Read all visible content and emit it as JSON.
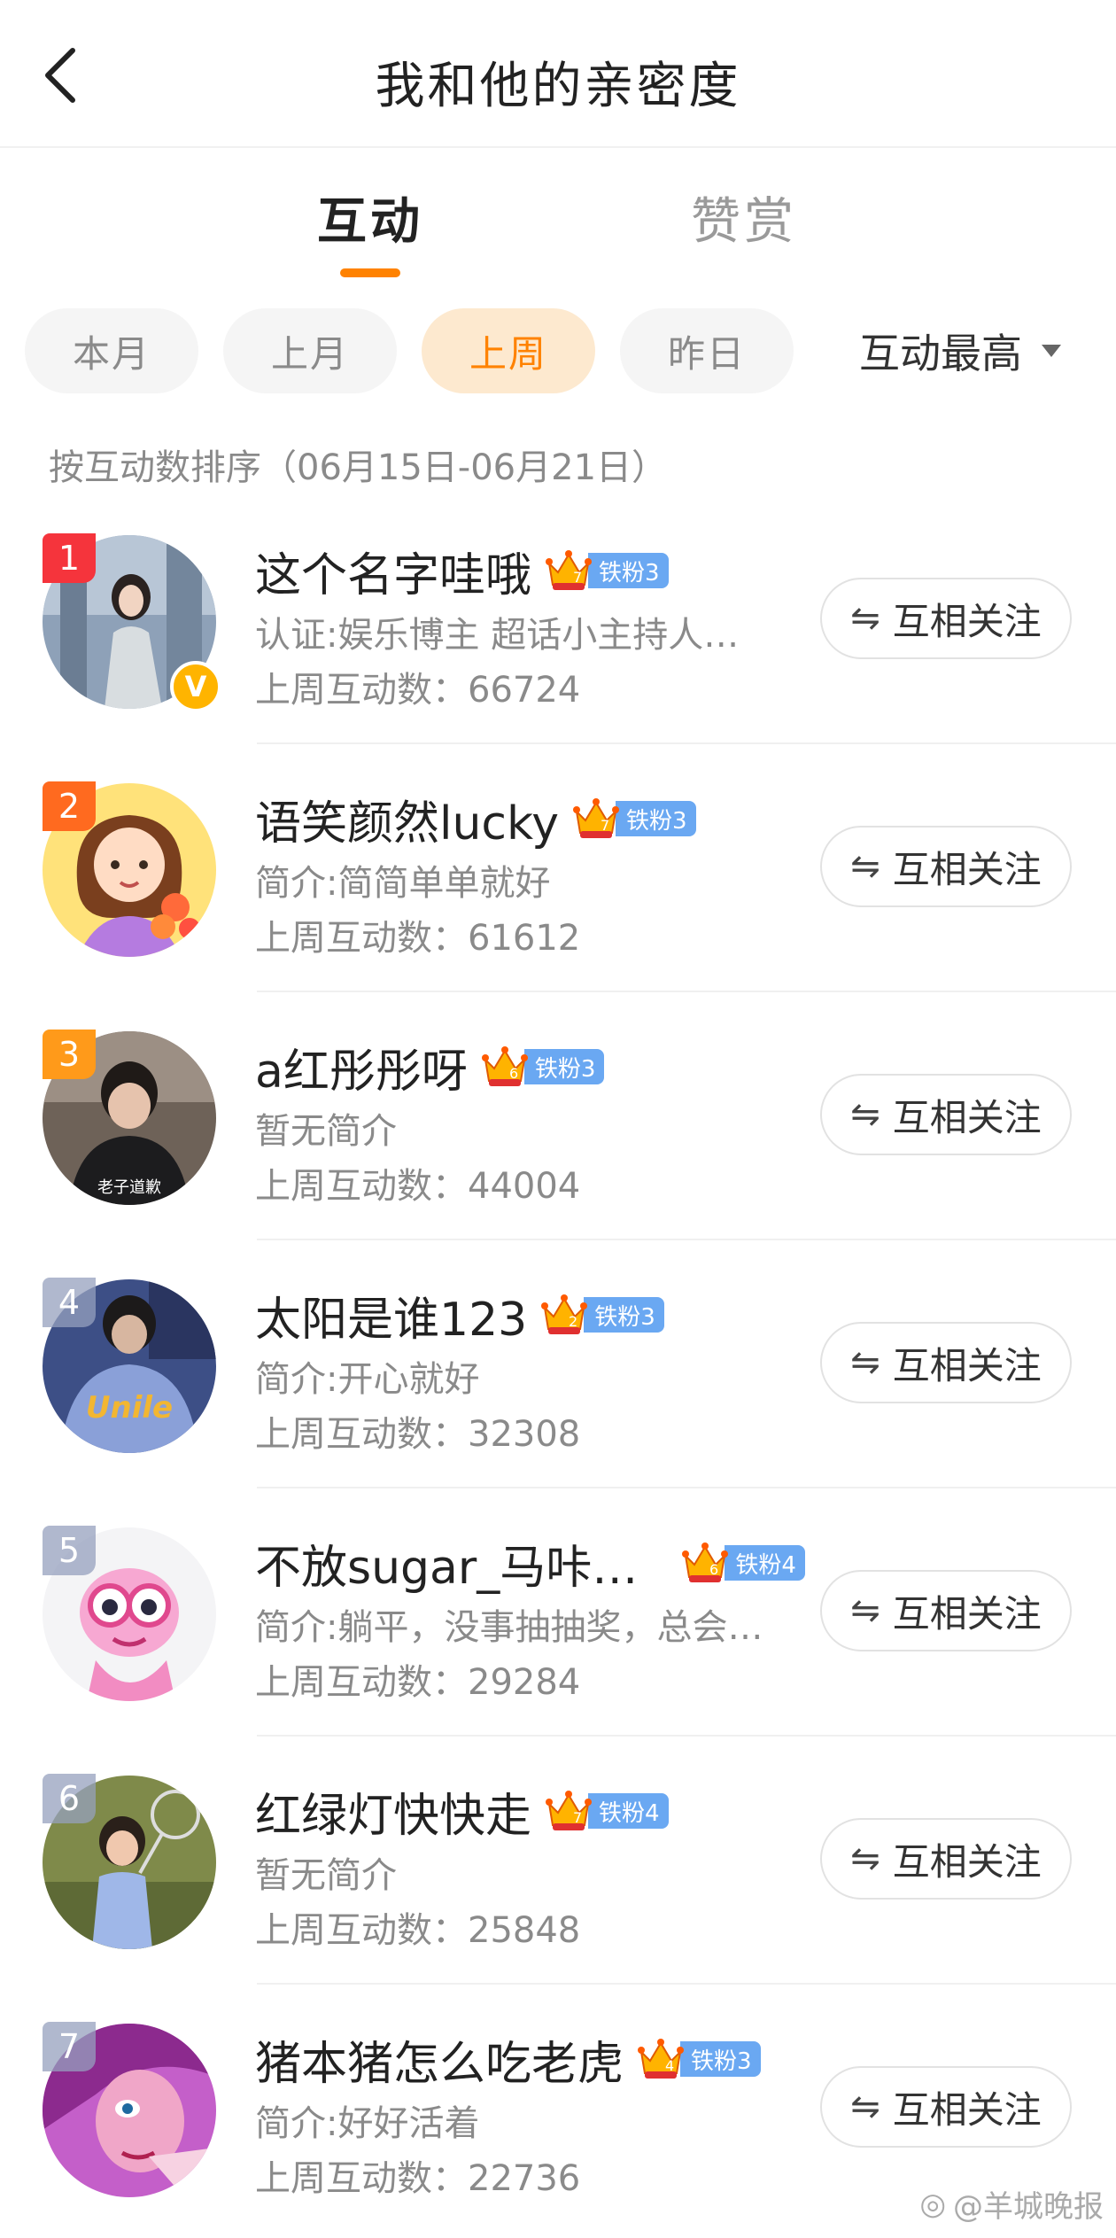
{
  "header": {
    "title": "我和他的亲密度"
  },
  "tabs": [
    {
      "label": "互动",
      "active": true
    },
    {
      "label": "赞赏",
      "active": false
    }
  ],
  "filters": {
    "chips": [
      {
        "label": "本月",
        "active": false
      },
      {
        "label": "上月",
        "active": false
      },
      {
        "label": "上周",
        "active": true
      },
      {
        "label": "昨日",
        "active": false
      }
    ],
    "sort_label": "互动最高"
  },
  "sort_description": "按互动数排序（06月15日-06月21日）",
  "follow_label": "互相关注",
  "colors": {
    "accent": "#ff8200",
    "fan_badge": "#6aa8f2"
  },
  "users": [
    {
      "rank": "1",
      "name": "这个名字哇哦",
      "crown_level": "7",
      "fan_level": "铁粉3",
      "bio": "认证:娱乐博主 超话小主持人…",
      "count": "上周互动数：66724",
      "verified": "V"
    },
    {
      "rank": "2",
      "name": "语笑颜然lucky",
      "crown_level": "7",
      "fan_level": "铁粉3",
      "bio": "简介:简简单单就好",
      "count": "上周互动数：61612"
    },
    {
      "rank": "3",
      "name": "a红彤彤呀",
      "crown_level": "6",
      "fan_level": "铁粉3",
      "bio": "暂无简介",
      "count": "上周互动数：44004",
      "avatar_caption": "老子道歉"
    },
    {
      "rank": "4",
      "name": "太阳是谁123",
      "crown_level": "2",
      "fan_level": "铁粉3",
      "bio": "简介:开心就好",
      "count": "上周互动数：32308",
      "avatar_caption": "Unile"
    },
    {
      "rank": "5",
      "name": "不放sugar_马咔…",
      "crown_level": "6",
      "fan_level": "铁粉4",
      "bio": "简介:躺平，没事抽抽奖，总会…",
      "count": "上周互动数：29284"
    },
    {
      "rank": "6",
      "name": "红绿灯快快走",
      "crown_level": "7",
      "fan_level": "铁粉4",
      "bio": "暂无简介",
      "count": "上周互动数：25848"
    },
    {
      "rank": "7",
      "name": "猪本猪怎么吃老虎",
      "crown_level": "4",
      "fan_level": "铁粉3",
      "bio": "简介:好好活着",
      "count": "上周互动数：22736"
    }
  ],
  "watermark": "@羊城晚报"
}
